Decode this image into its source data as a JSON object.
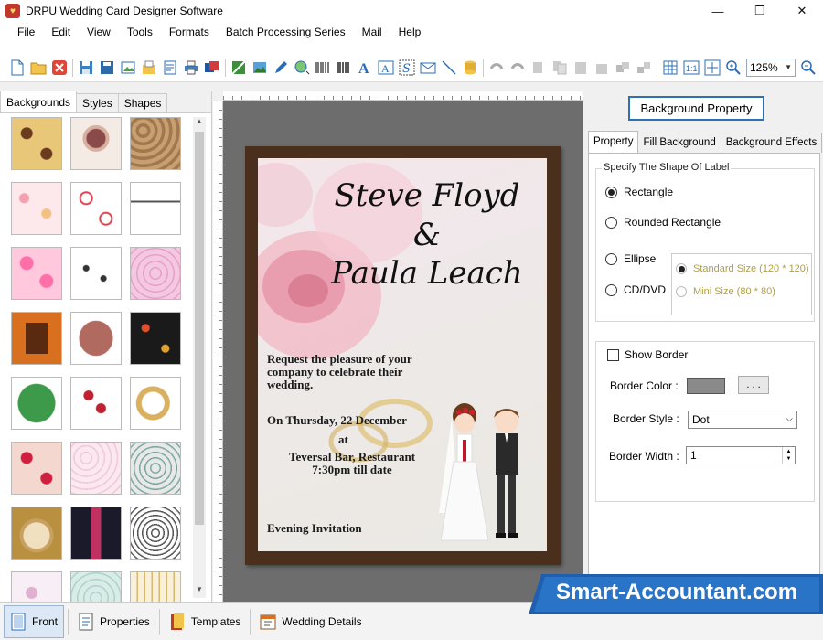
{
  "window": {
    "title": "DRPU Wedding Card Designer Software",
    "minimize": "—",
    "maximize": "❐",
    "close": "✕"
  },
  "menu": [
    "File",
    "Edit",
    "View",
    "Tools",
    "Formats",
    "Batch Processing Series",
    "Mail",
    "Help"
  ],
  "toolbar": {
    "zoom": "125%"
  },
  "left_panel": {
    "tabs": [
      "Backgrounds",
      "Styles",
      "Shapes"
    ],
    "active_tab": "Backgrounds"
  },
  "card": {
    "name1": "Steve Floyd",
    "amp": "&",
    "name2": "Paula Leach",
    "line1": "Request the pleasure of your",
    "line2": "company to celebrate their",
    "line3": "wedding.",
    "date": "On Thursday, 22 December",
    "at": "at",
    "venue": "Teversal Bar, Restaurant",
    "time": "7:30pm till date",
    "invite": "Evening Invitation"
  },
  "right_panel": {
    "header_button": "Background Property",
    "tabs": [
      "Property",
      "Fill Background",
      "Background Effects"
    ],
    "active_tab": "Property",
    "shape_group_title": "Specify The Shape Of Label",
    "shapes": {
      "rectangle": "Rectangle",
      "rounded": "Rounded Rectangle",
      "ellipse": "Ellipse",
      "cd": "CD/DVD"
    },
    "selected_shape": "Rectangle",
    "sizes": {
      "standard": "Standard Size (120 * 120)",
      "mini": "Mini Size (80 * 80)"
    },
    "show_border": "Show Border",
    "border_color_label": "Border Color :",
    "border_color": "#8a8a8a",
    "ellipsis": ". . .",
    "border_style_label": "Border Style :",
    "border_style": "Dot",
    "border_width_label": "Border Width :",
    "border_width": "1"
  },
  "bottom_bar": {
    "front": "Front",
    "properties": "Properties",
    "templates": "Templates",
    "wedding_details": "Wedding Details"
  },
  "watermark": "Smart-Accountant.com"
}
